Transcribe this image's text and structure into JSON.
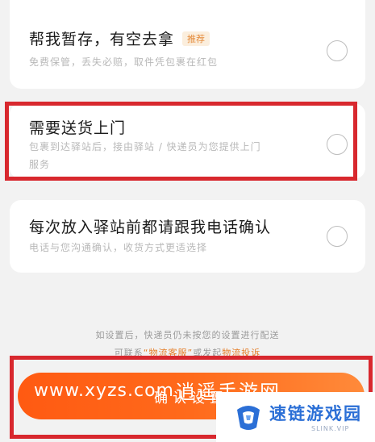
{
  "options": [
    {
      "title": "帮我暂存，有空去拿",
      "badge": "推荐",
      "desc": "免费保管，丢失必赔，取件凭包裹在红包"
    },
    {
      "title": "需要送货上门",
      "desc_line1": "包裹到达驿站后，接由驿站 / 快递员为您提供上门",
      "desc_line2": "服务"
    },
    {
      "title": "每次放入驿站前都请跟我电话确认",
      "desc": "电话与您沟通确认，收货方式更适选择"
    }
  ],
  "footer": {
    "note_line1": "如设置后，快递员仍未按您的设置进行配送",
    "note_line2_prefix": "可联系",
    "note_line2_link1": "“物流客服”",
    "note_line2_mid": "或发起",
    "note_line2_link2": "物流投诉",
    "confirm_label": "确认设置"
  },
  "watermark": {
    "url": "www.xyzs.com",
    "name": "逍遥手游网"
  },
  "brand": {
    "name": "速链游戏园",
    "sub": "SLINK.VIP"
  },
  "colors": {
    "accent": "#ff5a12",
    "highlight": "#d8282e",
    "brand": "#2b6fd6"
  }
}
